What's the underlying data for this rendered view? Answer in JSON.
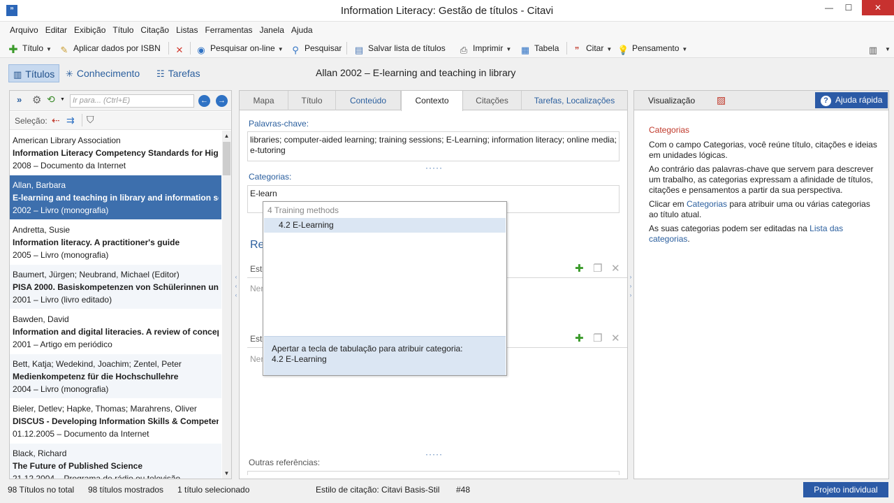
{
  "window": {
    "title": "Information Literacy: Gestão de títulos - Citavi",
    "app_icon": "citavi-icon",
    "minimize": "—",
    "maximize": "☐",
    "close": "✕"
  },
  "menu": [
    "Arquivo",
    "Editar",
    "Exibição",
    "Título",
    "Citação",
    "Listas",
    "Ferramentas",
    "Janela",
    "Ajuda"
  ],
  "toolbar": {
    "title": "Título",
    "isbn": "Aplicar dados por ISBN",
    "search_online": "Pesquisar on-line",
    "search": "Pesquisar",
    "save_list": "Salvar lista de títulos",
    "print": "Imprimir",
    "table": "Tabela",
    "cite": "Citar",
    "thought": "Pensamento"
  },
  "modes": {
    "titles": "Títulos",
    "knowledge": "Conhecimento",
    "tasks": "Tarefas"
  },
  "current_title": "Allan 2002 – E-learning and teaching in library",
  "left_panel": {
    "search_placeholder": "Ir para... (Ctrl+E)",
    "selection_label": "Seleção:",
    "records": [
      {
        "author": "American Library Association",
        "title": "Information Literacy Competency Standards for High",
        "meta": "2008 – Documento da Internet"
      },
      {
        "author": "Allan, Barbara",
        "title": "E-learning and teaching in library and information ser",
        "meta": "2002 – Livro (monografia)"
      },
      {
        "author": "Andretta, Susie",
        "title": "Information literacy. A practitioner's guide",
        "meta": "2005 – Livro (monografia)"
      },
      {
        "author": "Baumert, Jürgen; Neubrand, Michael (Editor)",
        "title": "PISA 2000. Basiskompetenzen von Schülerinnen und",
        "meta": "2001 – Livro (livro editado)"
      },
      {
        "author": "Bawden, David",
        "title": "Information and digital literacies. A review of concep",
        "meta": "2001 – Artigo em periódico"
      },
      {
        "author": "Bett, Katja; Wedekind, Joachim; Zentel, Peter",
        "title": "Medienkompetenz für die Hochschullehre",
        "meta": "2004 – Livro (monografia)"
      },
      {
        "author": "Bieler, Detlev; Hapke, Thomas; Marahrens, Oliver",
        "title": "DISCUS - Developing Information Skills & Competen",
        "meta": "01.12.2005 – Documento da Internet"
      },
      {
        "author": "Black, Richard",
        "title": "The Future of Published Science",
        "meta": "21.12.2004 – Programa de rádio ou televisão"
      }
    ]
  },
  "tabs": [
    "Mapa",
    "Título",
    "Conteúdo",
    "Contexto",
    "Citações",
    "Tarefas, Localizações"
  ],
  "context": {
    "keywords_label": "Palavras-chave:",
    "keywords_value": "libraries; computer-aided learning; training sessions; E-Learning; information literacy; online media; e-tutoring",
    "categories_label": "Categorias:",
    "categories_value": "E-learn",
    "section_heading": "Re",
    "sub1_label": "Este",
    "sub1_ghost": "Nen",
    "sub2_label": "Este",
    "sub2_ghost": "Nen",
    "other_refs_label": "Outras referências:",
    "dots": "·····"
  },
  "dropdown": {
    "group": "4 Training methods",
    "option": "4.2 E-Learning",
    "hint_line1": "Apertar a tecla de tabulação para atribuir categoria:",
    "hint_line2": "4.2 E-Learning"
  },
  "right_panel": {
    "visualization": "Visualização",
    "help_button": "Ajuda rápida",
    "heading": "Categorias",
    "p1": "Com o campo Categorias, você reúne título, citações e ideias em unidades lógicas.",
    "p2": "Ao contrário das palavras-chave que servem para descrever um trabalho, as categorias expressam a afinidade de títulos, citações e pensamentos a partir da sua perspectiva.",
    "p3_pre": "Clicar em ",
    "p3_link": "Categorias",
    "p3_post": " para atribuir uma ou várias categorias ao título atual.",
    "p4_pre": "As suas categorias podem ser editadas na ",
    "p4_link": "Lista das categorias",
    "p4_post": "."
  },
  "status": {
    "total": "98 Títulos no total",
    "shown": "98 títulos mostrados",
    "selected": "1 título selecionado",
    "style": "Estilo de citação: Citavi Basis-Stil",
    "number": "#48",
    "project": "Projeto individual"
  },
  "colors": {
    "accent": "#2b5aa6",
    "selection": "#3d6fad",
    "link": "#2b5f9e",
    "help_heading": "#c0392b"
  }
}
